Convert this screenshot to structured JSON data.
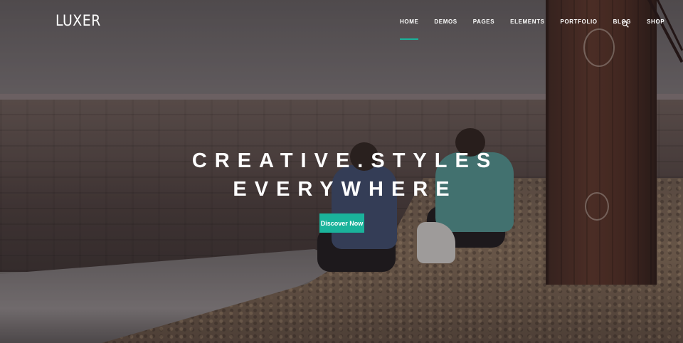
{
  "brand": {
    "logo_text": "LUXER"
  },
  "nav": {
    "items": [
      {
        "label": "HOME",
        "active": true
      },
      {
        "label": "DEMOS",
        "active": false
      },
      {
        "label": "PAGES",
        "active": false
      },
      {
        "label": "ELEMENTS",
        "active": false
      },
      {
        "label": "PORTFOLIO",
        "active": false
      },
      {
        "label": "BLOG",
        "active": false
      },
      {
        "label": "SHOP",
        "active": false
      }
    ],
    "search_icon": "search-icon"
  },
  "hero": {
    "headline_line1": "CREATIVE.STYLES",
    "headline_line2": "EVERYWHERE",
    "cta_label": "Discover Now",
    "background_image": "two people sitting on a pebble beach by a stone wall and a rusty post"
  },
  "colors": {
    "accent": "#1ab39b",
    "text": "#ffffff"
  }
}
